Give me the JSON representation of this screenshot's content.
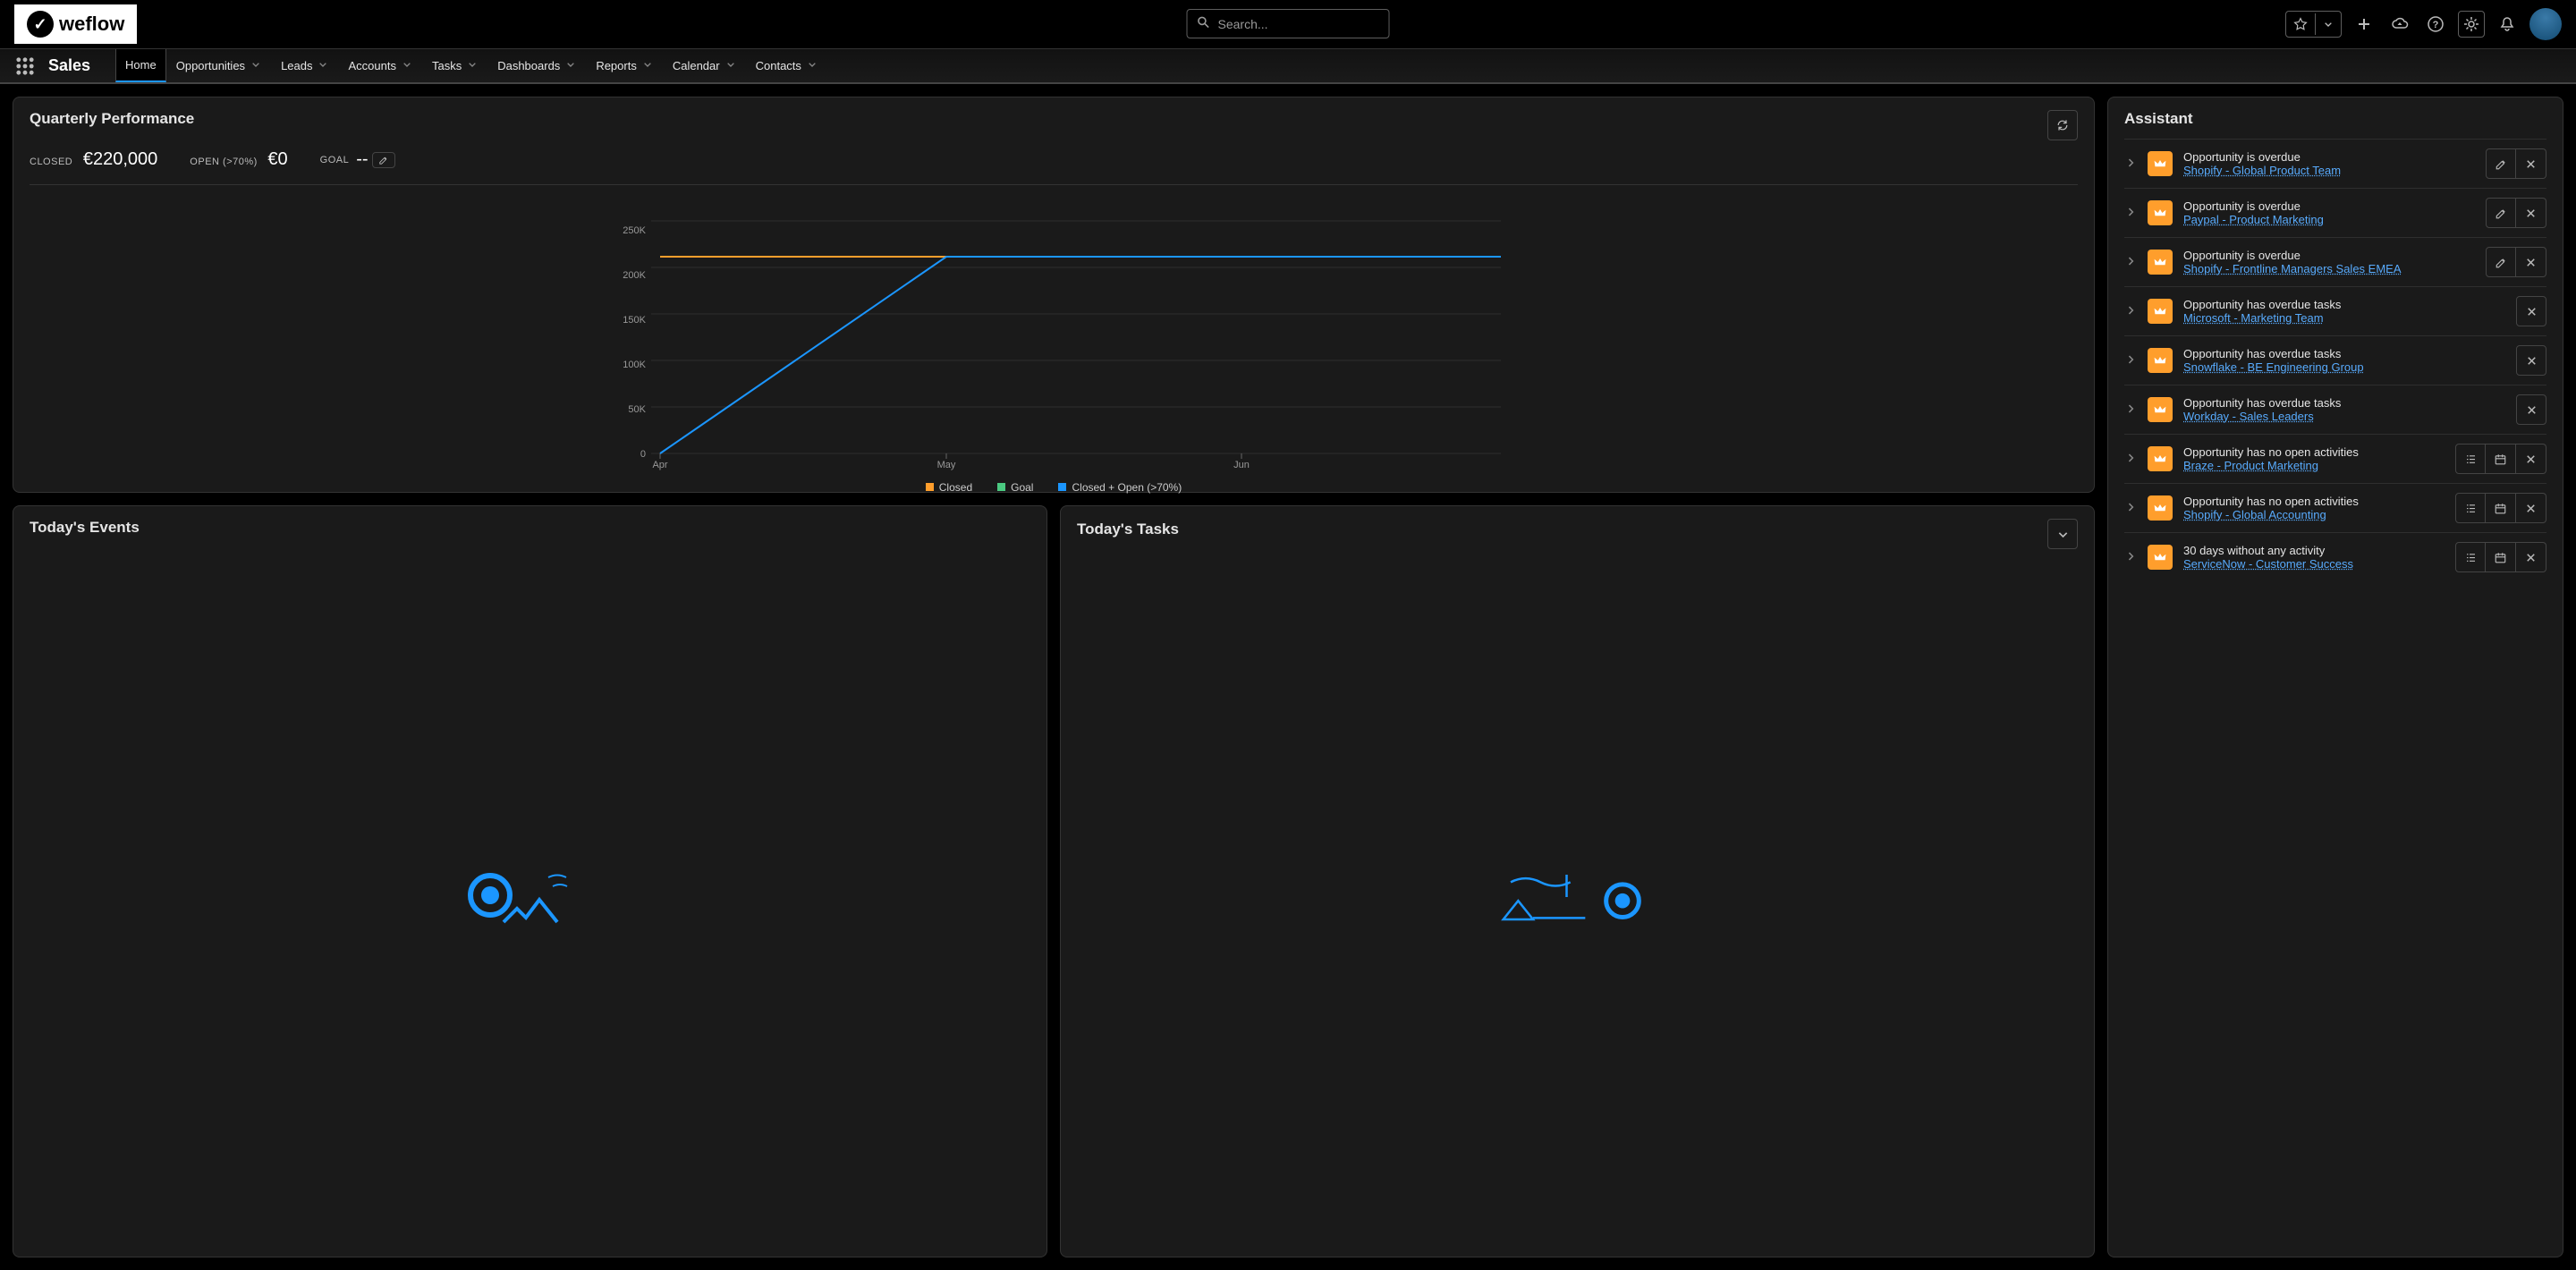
{
  "logo": {
    "text": "weflow"
  },
  "search": {
    "placeholder": "Search..."
  },
  "app_name": "Sales",
  "nav": {
    "items": [
      {
        "label": "Home",
        "active": true
      },
      {
        "label": "Opportunities"
      },
      {
        "label": "Leads"
      },
      {
        "label": "Accounts"
      },
      {
        "label": "Tasks"
      },
      {
        "label": "Dashboards"
      },
      {
        "label": "Reports"
      },
      {
        "label": "Calendar"
      },
      {
        "label": "Contacts"
      }
    ]
  },
  "performance": {
    "title": "Quarterly Performance",
    "metrics": {
      "closed_label": "CLOSED",
      "closed_value": "€220,000",
      "open_label": "OPEN (>70%)",
      "open_value": "€0",
      "goal_label": "GOAL",
      "goal_value": "--"
    },
    "legend": {
      "closed": "Closed",
      "goal": "Goal",
      "closed_open": "Closed + Open (>70%)"
    }
  },
  "chart_data": {
    "type": "line",
    "x": [
      "Apr",
      "May",
      "Jun"
    ],
    "x_ticks_months": [
      "Apr",
      "May",
      "Jun"
    ],
    "ylabel": "",
    "y_ticks": [
      0,
      50000,
      100000,
      150000,
      200000,
      250000
    ],
    "y_tick_labels": [
      "0",
      "50K",
      "100K",
      "150K",
      "200K",
      "250K"
    ],
    "ylim": [
      0,
      260000
    ],
    "series": [
      {
        "name": "Closed",
        "color": "#ff9e2c",
        "values": [
          220000,
          220000,
          220000
        ]
      },
      {
        "name": "Closed + Open (>70%)",
        "color": "#1b96ff",
        "values": [
          0,
          220000,
          220000
        ]
      }
    ]
  },
  "events": {
    "title": "Today's Events"
  },
  "tasks": {
    "title": "Today's Tasks"
  },
  "assistant": {
    "title": "Assistant",
    "items": [
      {
        "heading": "Opportunity is overdue",
        "link": "Shopify - Global Product Team",
        "edit": true,
        "close": true
      },
      {
        "heading": "Opportunity is overdue",
        "link": "Paypal - Product Marketing",
        "edit": true,
        "close": true
      },
      {
        "heading": "Opportunity is overdue",
        "link": "Shopify - Frontline Managers Sales EMEA",
        "edit": true,
        "close": true
      },
      {
        "heading": "Opportunity has overdue tasks",
        "link": "Microsoft - Marketing Team",
        "close": true
      },
      {
        "heading": "Opportunity has overdue tasks",
        "link": "Snowflake - BE Engineering Group",
        "close": true
      },
      {
        "heading": "Opportunity has overdue tasks",
        "link": "Workday - Sales Leaders",
        "close": true
      },
      {
        "heading": "Opportunity has no open activities",
        "link": "Braze - Product Marketing",
        "list": true,
        "cal": true,
        "close": true
      },
      {
        "heading": "Opportunity has no open activities",
        "link": "Shopify - Global Accounting",
        "list": true,
        "cal": true,
        "close": true
      },
      {
        "heading": "30 days without any activity",
        "link": "ServiceNow - Customer Success",
        "list": true,
        "cal": true,
        "close": true
      }
    ]
  }
}
